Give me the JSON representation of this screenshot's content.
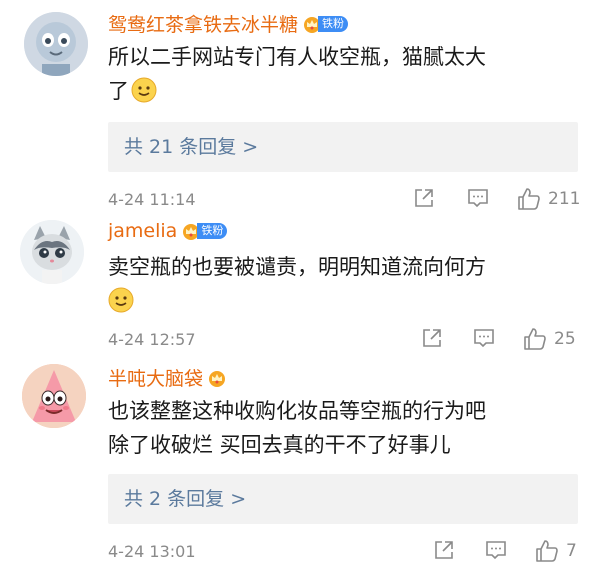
{
  "comments": [
    {
      "username": "鸳鸯红茶拿铁去冰半糖",
      "badge": "铁粉",
      "text_line1": "所以二手网站专门有人收空瓶，猫腻太大",
      "text_line2": "了",
      "emoji": "smile-emoji",
      "replies": "共 21 条回复 >",
      "time": "4-24 11:14",
      "likes": "211"
    },
    {
      "username": "jamelia",
      "badge": "铁粉",
      "text_line1": "卖空瓶的也要被谴责，明明知道流向何方",
      "time": "4-24 12:57",
      "likes": "25"
    },
    {
      "username": "半吨大脑袋",
      "text_line1": "也该整整这种收购化妆品等空瓶的行为吧",
      "text_line2": "除了收破烂 买回去真的干不了好事儿",
      "replies": "共 2 条回复 >",
      "time": "4-24 13:01",
      "likes": "7"
    }
  ],
  "colors": {
    "username": "#e86b12",
    "reply_link": "#5b7a9d",
    "meta": "#8a8a8a",
    "badge": "#3d8df5"
  },
  "icons": [
    "share-icon",
    "comment-icon",
    "like-icon",
    "crown-icon",
    "smile-emoji"
  ]
}
